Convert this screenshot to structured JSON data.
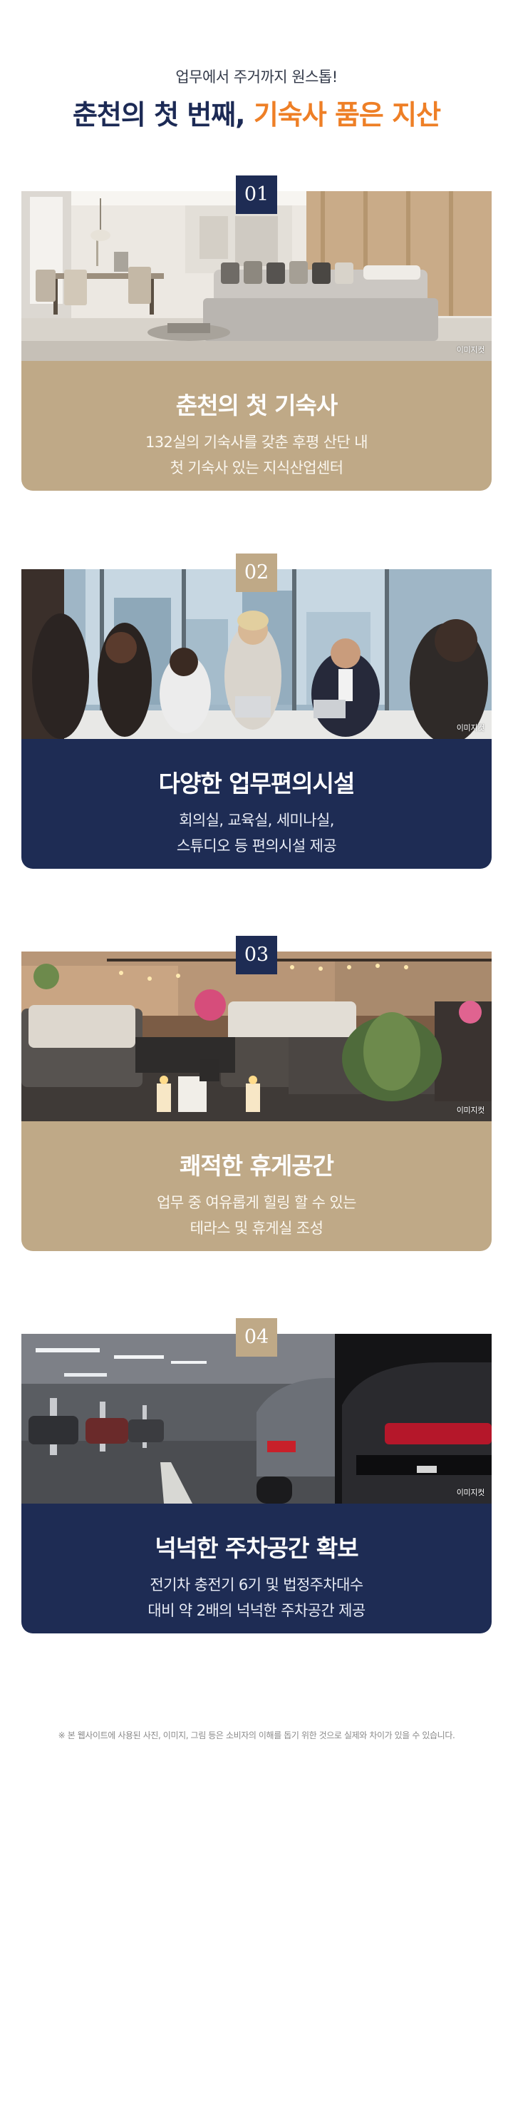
{
  "header": {
    "subtitle": "업무에서 주거까지 원스톱!",
    "title_main": "춘천의 첫 번째, ",
    "title_accent": "기숙사 품은 지산"
  },
  "colors": {
    "navy": "#1e2c54",
    "tan": "#bfa987",
    "accent": "#ee7f26"
  },
  "features": [
    {
      "number": "01",
      "image_label": "이미지컷",
      "title": "춘천의 첫 기숙사",
      "desc_line1": "132실의 기숙사를 갖춘 후평 산단 내",
      "desc_line2": "첫 기숙사 있는 지식산업센터"
    },
    {
      "number": "02",
      "image_label": "이미지컷",
      "title": "다양한 업무편의시설",
      "desc_line1": "회의실, 교육실, 세미나실,",
      "desc_line2": "스튜디오 등 편의시설 제공"
    },
    {
      "number": "03",
      "image_label": "이미지컷",
      "title": "쾌적한 휴게공간",
      "desc_line1": "업무 중 여유롭게 힐링 할 수 있는",
      "desc_line2": "테라스 및 휴게실 조성"
    },
    {
      "number": "04",
      "image_label": "이미지컷",
      "title": "넉넉한 주차공간 확보",
      "desc_line1": "전기차 충전기 6기 및 법정주차대수",
      "desc_line2": "대비 약 2배의 넉넉한 주차공간 제공"
    }
  ],
  "disclaimer": "※ 본 웹사이트에 사용된 사진, 이미지, 그림 등은 소비자의 이해를 돕기 위한 것으로 실제와 차이가 있을 수 있습니다."
}
